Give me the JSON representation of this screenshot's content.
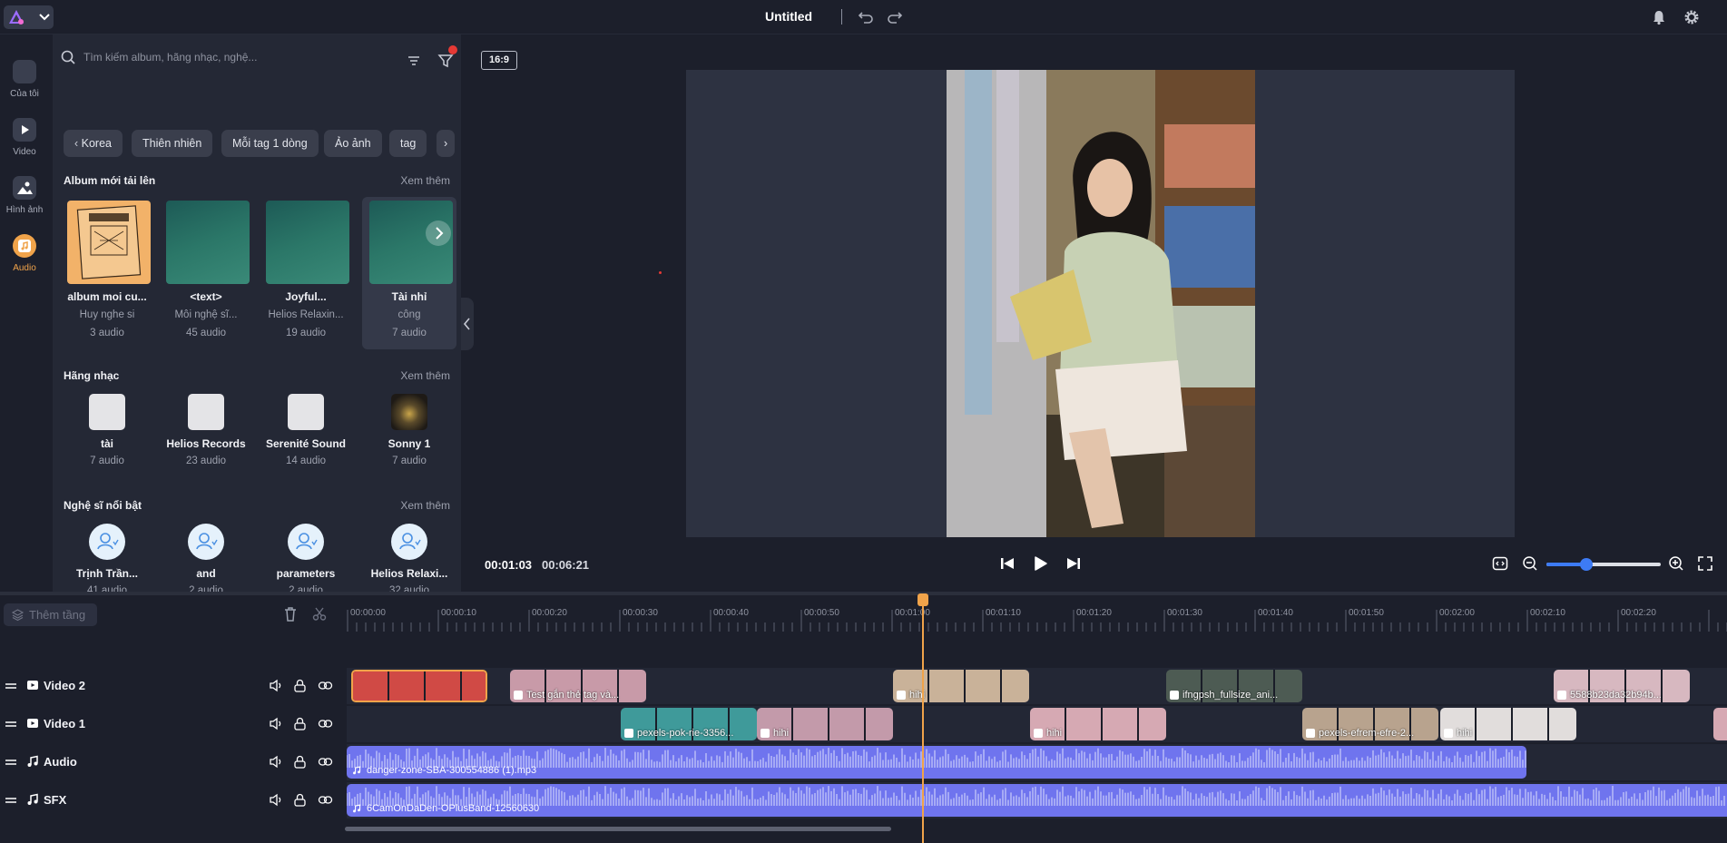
{
  "app": {
    "title": "Untitled",
    "accent_color": "#f0a34a",
    "header_icons": [
      "undo-icon",
      "redo-icon",
      "bell-icon",
      "gear-icon"
    ]
  },
  "rail": [
    {
      "label": "Của tôi",
      "icon": "folder-icon"
    },
    {
      "label": "Video",
      "icon": "video-icon"
    },
    {
      "label": "Hình ảnh",
      "icon": "image-icon"
    },
    {
      "label": "Audio",
      "icon": "music-icon",
      "active": true
    }
  ],
  "library": {
    "search_placeholder": "Tìm kiếm album, hãng nhạc, nghệ...",
    "chips": [
      "Korea",
      "Thiên nhiên",
      "Mỗi tag 1 dòng",
      "Ảo ảnh",
      "tag"
    ],
    "albums_section": {
      "title": "Album mới tải lên",
      "see_more": "Xem thêm",
      "items": [
        {
          "name": "album moi cu...",
          "artist": "Huy nghe si",
          "count": "3 audio"
        },
        {
          "name": "<text>",
          "artist": "Môi nghệ sĩ...",
          "count": "45 audio"
        },
        {
          "name": "Joyful...",
          "artist": "Helios Relaxin...",
          "count": "19 audio"
        },
        {
          "name": "Tài nhỉ",
          "artist": "công",
          "count": "7 audio"
        }
      ]
    },
    "labels_section": {
      "title": "Hãng nhạc",
      "see_more": "Xem thêm",
      "items": [
        {
          "name": "tài",
          "count": "7 audio"
        },
        {
          "name": "Helios Records",
          "count": "23 audio"
        },
        {
          "name": "Serenité Sound",
          "count": "14 audio"
        },
        {
          "name": "Sonny 1",
          "count": "7 audio"
        }
      ]
    },
    "artists_section": {
      "title": "Nghệ sĩ nổi bật",
      "see_more": "Xem thêm",
      "items": [
        {
          "name": "Trịnh Trần...",
          "count": "41 audio"
        },
        {
          "name": "and",
          "count": "2 audio"
        },
        {
          "name": "parameters",
          "count": "2 audio"
        },
        {
          "name": "Helios Relaxi...",
          "count": "32 audio"
        }
      ]
    }
  },
  "preview": {
    "aspect_ratio": "16:9",
    "current_time": "00:01:03",
    "total_time": "00:06:21",
    "zoom_level": 0.35
  },
  "timeline": {
    "add_layer_label": "Thêm tầng",
    "ruler_ticks": [
      "00:00:00",
      "00:00:10",
      "00:00:20",
      "00:00:30",
      "00:00:40",
      "00:00:50",
      "00:01:00",
      "00:01:10",
      "00:01:20",
      "00:01:30",
      "00:01:40",
      "00:01:50",
      "00:02:00",
      "00:02:10",
      "00:02:20"
    ],
    "tracks": [
      {
        "name": "Video 2",
        "type": "video",
        "clips": [
          {
            "label": "",
            "start": "00:00:00",
            "color": "#d04a45",
            "selected": true
          },
          {
            "label": "Test gắn thẻ tag và...",
            "start": "00:00:18",
            "color": "#c89aa8"
          },
          {
            "label": "hihi",
            "start": "00:01:00",
            "color": "#c9b299"
          },
          {
            "label": "ifngpsh_fullsize_ani...",
            "start": "00:01:30",
            "color": "#4d5b53"
          },
          {
            "label": "5588b23da32b94b...",
            "start": "00:02:12",
            "color": "#d7b8c0"
          }
        ]
      },
      {
        "name": "Video 1",
        "type": "video",
        "clips": [
          {
            "label": "pexels-pok-rie-3356...",
            "start": "00:00:30",
            "color": "#3f9a9a"
          },
          {
            "label": "hihi",
            "start": "00:00:45",
            "color": "#c39aaa"
          },
          {
            "label": "hihi",
            "start": "00:01:15",
            "color": "#d6a9b3"
          },
          {
            "label": "pexels-efrem-efre-2...",
            "start": "00:01:45",
            "color": "#b8a38e"
          },
          {
            "label": "hihi",
            "start": "00:02:00",
            "color": "#e1dddc"
          }
        ]
      },
      {
        "name": "Audio",
        "type": "audio",
        "clips": [
          {
            "label": "danger-zone-SBA-300554886 (1).mp3",
            "start": "00:00:00"
          }
        ]
      },
      {
        "name": "SFX",
        "type": "audio",
        "clips": [
          {
            "label": "6CamOnDaDen-OPlusBand-12560630",
            "start": "00:00:00"
          }
        ]
      }
    ]
  }
}
